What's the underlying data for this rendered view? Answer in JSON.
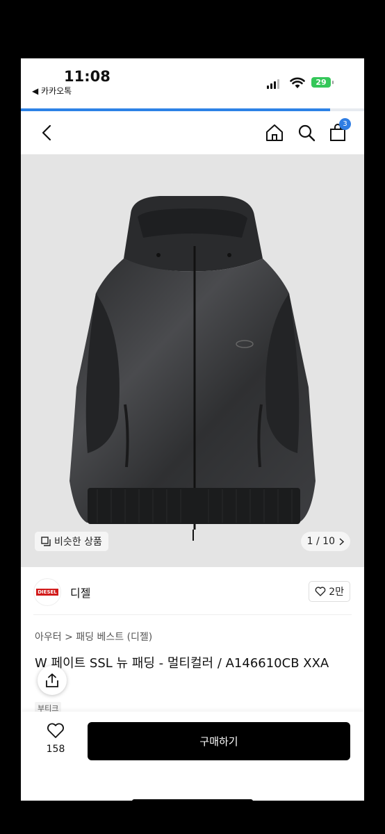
{
  "status_bar": {
    "time": "11:08",
    "back_app": "◀ 카카오톡",
    "battery": "29"
  },
  "progress": {
    "fraction": 0.9
  },
  "nav": {
    "cart_count": "3"
  },
  "gallery": {
    "similar_label": "비슷한 상품",
    "counter": "1 / 10",
    "background": "#e4e4e4"
  },
  "brand": {
    "logo_text": "DIESEL",
    "name": "디젤",
    "likes": "2만"
  },
  "breadcrumb": "아우터 > 패딩 베스트 (디젤)",
  "product": {
    "title": "W 페이트 SSL 뉴 패딩 - 멀티컬러 / A146610CB XXA",
    "tag": "부티크"
  },
  "bottom_bar": {
    "wish_count": "158",
    "buy_label": "구매하기"
  },
  "colors": {
    "accent": "#2d82e6",
    "battery": "#34c759",
    "brand_red": "#d11a1a",
    "buy_button": "#000000"
  }
}
